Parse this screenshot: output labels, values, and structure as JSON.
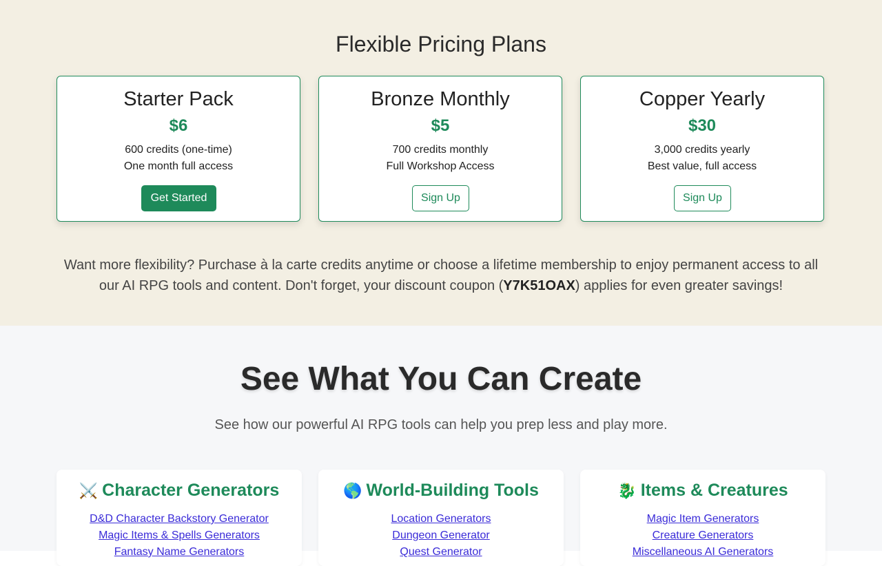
{
  "pricing": {
    "title": "Flexible Pricing Plans",
    "plans": [
      {
        "name": "Starter Pack",
        "price": "$6",
        "line1": "600 credits (one-time)",
        "line2": "One month full access",
        "button": "Get Started"
      },
      {
        "name": "Bronze Monthly",
        "price": "$5",
        "line1": "700 credits monthly",
        "line2": "Full Workshop Access",
        "button": "Sign Up"
      },
      {
        "name": "Copper Yearly",
        "price": "$30",
        "line1": "3,000 credits yearly",
        "line2": "Best value, full access",
        "button": "Sign Up"
      }
    ],
    "note_before": "Want more flexibility? Purchase à la carte credits anytime or choose a lifetime membership to enjoy permanent access to all our AI RPG tools and content. Don't forget, your discount coupon (",
    "coupon": "Y7K51OAX",
    "note_after": ") applies for even greater savings!"
  },
  "create": {
    "title": "See What You Can Create",
    "subtitle": "See how our powerful AI RPG tools can help you prep less and play more.",
    "categories": [
      {
        "emoji": "⚔️",
        "title": "Character Generators",
        "links": [
          "D&D Character Backstory Generator",
          "Magic Items & Spells Generators",
          "Fantasy Name Generators"
        ]
      },
      {
        "emoji": "🌎",
        "title": "World-Building Tools",
        "links": [
          "Location Generators",
          "Dungeon Generator",
          "Quest Generator"
        ]
      },
      {
        "emoji": "🐉",
        "title": "Items & Creatures",
        "links": [
          "Magic Item Generators",
          "Creature Generators",
          "Miscellaneous AI Generators"
        ]
      }
    ]
  },
  "colors": {
    "accent": "#1e8a5a",
    "pricing_bg": "#f3efe3",
    "section_bg": "#f6f7f9",
    "link": "#3a2bd8"
  }
}
